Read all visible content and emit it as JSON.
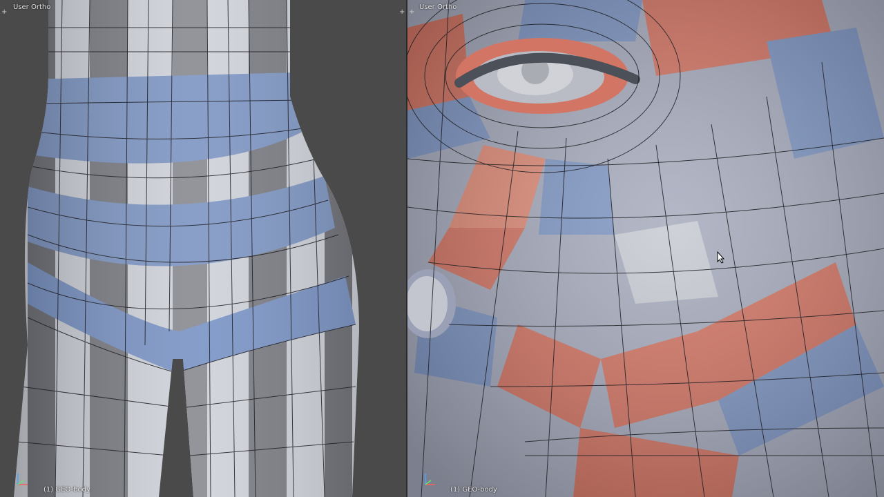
{
  "viewports": [
    {
      "view_label": "User Ortho",
      "object_label": "(1) GEO-body"
    },
    {
      "view_label": "User Ortho",
      "object_label": "(1) GEO-body"
    }
  ],
  "icons": {
    "split_handle": "plus-icon",
    "axis_gizmo": "axis-gizmo-icon",
    "mouse_cursor": "cursor-icon"
  },
  "colors": {
    "background": "#4a4a4a",
    "mesh_white": "#dadce2",
    "mesh_gray": "#7b7d84",
    "mesh_blue": "#7f97c4",
    "mesh_red": "#d37564",
    "wire": "#1e1e22"
  }
}
